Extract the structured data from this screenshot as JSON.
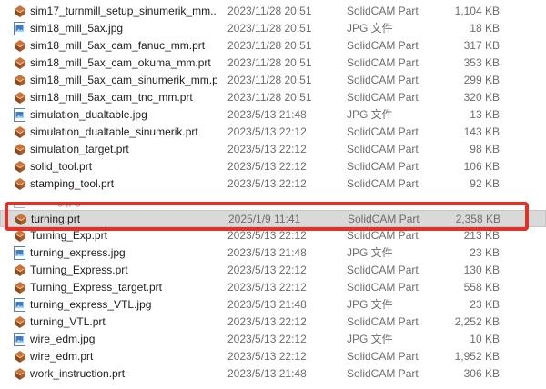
{
  "colors": {
    "selection": "#d9d9d9",
    "highlight_outline": "#e03228",
    "secondary_text": "#6d6d6d"
  },
  "files": [
    {
      "name": "sim17_turnmill_setup_sinumerik_mm....",
      "date": "2023/11/28 20:51",
      "type": "SolidCAM Part",
      "size": "1,104 KB",
      "icon": "solidcam-part-icon"
    },
    {
      "name": "sim18_mill_5ax.jpg",
      "date": "2023/11/28 20:51",
      "type": "JPG 文件",
      "size": "18 KB",
      "icon": "jpg-image-icon"
    },
    {
      "name": "sim18_mill_5ax_cam_fanuc_mm.prt",
      "date": "2023/11/28 20:51",
      "type": "SolidCAM Part",
      "size": "317 KB",
      "icon": "solidcam-part-icon"
    },
    {
      "name": "sim18_mill_5ax_cam_okuma_mm.prt",
      "date": "2023/11/28 20:51",
      "type": "SolidCAM Part",
      "size": "353 KB",
      "icon": "solidcam-part-icon"
    },
    {
      "name": "sim18_mill_5ax_cam_sinumerik_mm.prt",
      "date": "2023/11/28 20:51",
      "type": "SolidCAM Part",
      "size": "299 KB",
      "icon": "solidcam-part-icon"
    },
    {
      "name": "sim18_mill_5ax_cam_tnc_mm.prt",
      "date": "2023/11/28 20:51",
      "type": "SolidCAM Part",
      "size": "320 KB",
      "icon": "solidcam-part-icon"
    },
    {
      "name": "simulation_dualtable.jpg",
      "date": "2023/5/13 21:48",
      "type": "JPG 文件",
      "size": "13 KB",
      "icon": "jpg-image-icon"
    },
    {
      "name": "simulation_dualtable_sinumerik.prt",
      "date": "2023/5/13 22:12",
      "type": "SolidCAM Part",
      "size": "143 KB",
      "icon": "solidcam-part-icon"
    },
    {
      "name": "simulation_target.prt",
      "date": "2023/5/13 22:12",
      "type": "SolidCAM Part",
      "size": "98 KB",
      "icon": "solidcam-part-icon"
    },
    {
      "name": "solid_tool.prt",
      "date": "2023/5/13 22:12",
      "type": "SolidCAM Part",
      "size": "106 KB",
      "icon": "solidcam-part-icon"
    },
    {
      "name": "stamping_tool.prt",
      "date": "2023/5/13 22:12",
      "type": "SolidCAM Part",
      "size": "92 KB",
      "icon": "solidcam-part-icon"
    },
    {
      "name": "turning.jpg",
      "date": "2023/5/13 22:12",
      "type": "JPG 文件",
      "size": "8 KB",
      "icon": "jpg-image-icon",
      "state": "occluded"
    },
    {
      "name": "turning.prt",
      "date": "2025/1/9 11:41",
      "type": "SolidCAM Part",
      "size": "2,358 KB",
      "icon": "solidcam-part-icon",
      "state": "selected"
    },
    {
      "name": "Turning_Exp.prt",
      "date": "2023/5/13 22:12",
      "type": "SolidCAM Part",
      "size": "213 KB",
      "icon": "solidcam-part-icon",
      "state": "partial"
    },
    {
      "name": "turning_express.jpg",
      "date": "2023/5/13 21:48",
      "type": "JPG 文件",
      "size": "23 KB",
      "icon": "jpg-image-icon"
    },
    {
      "name": "Turning_Express.prt",
      "date": "2023/5/13 22:12",
      "type": "SolidCAM Part",
      "size": "130 KB",
      "icon": "solidcam-part-icon"
    },
    {
      "name": "Turning_Express_target.prt",
      "date": "2023/5/13 22:12",
      "type": "SolidCAM Part",
      "size": "558 KB",
      "icon": "solidcam-part-icon"
    },
    {
      "name": "turning_express_VTL.jpg",
      "date": "2023/5/13 21:48",
      "type": "JPG 文件",
      "size": "23 KB",
      "icon": "jpg-image-icon"
    },
    {
      "name": "turning_VTL.prt",
      "date": "2023/5/13 22:12",
      "type": "SolidCAM Part",
      "size": "2,252 KB",
      "icon": "solidcam-part-icon"
    },
    {
      "name": "wire_edm.jpg",
      "date": "2023/5/13 22:12",
      "type": "JPG 文件",
      "size": "10 KB",
      "icon": "jpg-image-icon"
    },
    {
      "name": "wire_edm.prt",
      "date": "2023/5/13 22:12",
      "type": "SolidCAM Part",
      "size": "1,952 KB",
      "icon": "solidcam-part-icon"
    },
    {
      "name": "work_instruction.prt",
      "date": "2023/5/13 21:48",
      "type": "SolidCAM Part",
      "size": "306 KB",
      "icon": "solidcam-part-icon"
    }
  ]
}
